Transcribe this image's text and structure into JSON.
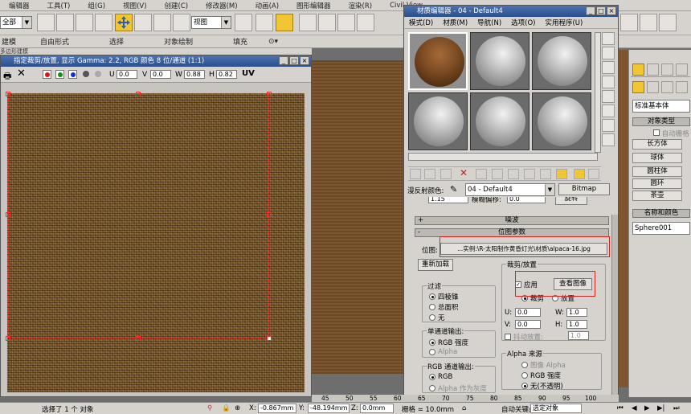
{
  "menubar": [
    "编辑器",
    "工具(T)",
    "组(G)",
    "视图(V)",
    "创建(C)",
    "修改器(M)",
    "动画(A)",
    "图形编辑器",
    "渲染(R)",
    "Civil View"
  ],
  "main_toolbar": {
    "scope_combo": "全部",
    "view_combo": "视图"
  },
  "ribbon": {
    "tabs": [
      "建模",
      "自由形式",
      "选择",
      "对象绘制",
      "填充"
    ],
    "sub_label": "多边形建模"
  },
  "frame_buffer": {
    "title": "指定裁剪/放置, 显示 Gamma: 2.2, RGB 颜色 8 位/通道 (1:1)",
    "u_label": "U",
    "u_value": "0.0",
    "v_label": "V",
    "v_value": "0.0",
    "w_label": "W",
    "w_value": "0.88",
    "h_label": "H",
    "h_value": "0.82",
    "uv_label": "UV",
    "channel_colors": [
      "#e01010",
      "#109010",
      "#1030d0"
    ]
  },
  "material_editor": {
    "title": "材质编辑器 - 04 - Default4",
    "menu": [
      "模式(D)",
      "材质(M)",
      "导航(N)",
      "选项(O)",
      "实用程序(U)"
    ],
    "diffuse_label": "漫反射颜色:",
    "material_name": "04 - Default4",
    "map_type": "Bitmap",
    "partial_row": {
      "tiling": "1.15",
      "blur_label": "模糊偏移:",
      "blur_value": "0.0",
      "rotate_label": "旋转"
    },
    "noise_rollout": "噪波",
    "bitmap_params_rollout": "位图参数",
    "bitmap_label": "位图:",
    "bitmap_path": "...实例:\\R-太阳制作黄昏灯光\\材质\\alpaca-16.jpg",
    "reload_button": "重新加载",
    "crop_group": "裁剪/放置",
    "apply_label": "应用",
    "view_image_button": "查看图像",
    "crop_radio": "裁剪",
    "place_radio": "放置",
    "crop_u_label": "U:",
    "crop_u": "0.0",
    "crop_w_label": "W:",
    "crop_w": "1.0",
    "crop_v_label": "V:",
    "crop_v": "0.0",
    "crop_h_label": "H:",
    "crop_h": "1.0",
    "jitter_label": "抖动放置:",
    "jitter_value": "1.0",
    "filter_group": "过滤",
    "filter_options": [
      "四棱锥",
      "总面积",
      "无"
    ],
    "mono_group": "单通道输出:",
    "mono_options": [
      "RGB 强度",
      "Alpha"
    ],
    "rgb_group": "RGB 通道输出:",
    "rgb_options": [
      "RGB",
      "Alpha 作为灰度"
    ],
    "alpha_group": "Alpha 来源",
    "alpha_options": [
      "图像 Alpha",
      "RGB 强度",
      "无(不透明)"
    ]
  },
  "command_panel": {
    "category": "标准基本体",
    "object_type_rollout": "对象类型",
    "autogrid": "自动栅格",
    "buttons": [
      "长方体",
      "球体",
      "圆柱体",
      "圆环",
      "茶壶"
    ],
    "name_color_rollout": "名称和颜色",
    "object_name": "Sphere001"
  },
  "timeline_ruler": [
    "45",
    "50",
    "55",
    "60",
    "65",
    "70",
    "75",
    "80",
    "85",
    "90",
    "95",
    "100"
  ],
  "statusbar": {
    "selection": "选择了 1 个 对象",
    "x_label": "X:",
    "x_value": "-0.867mm",
    "y_label": "Y:",
    "y_value": "-48.194mm",
    "z_label": "Z:",
    "z_value": "0.0mm",
    "grid": "栅格 = 10.0mm",
    "autokey": "自动关键点",
    "selected_set": "选定对象"
  }
}
